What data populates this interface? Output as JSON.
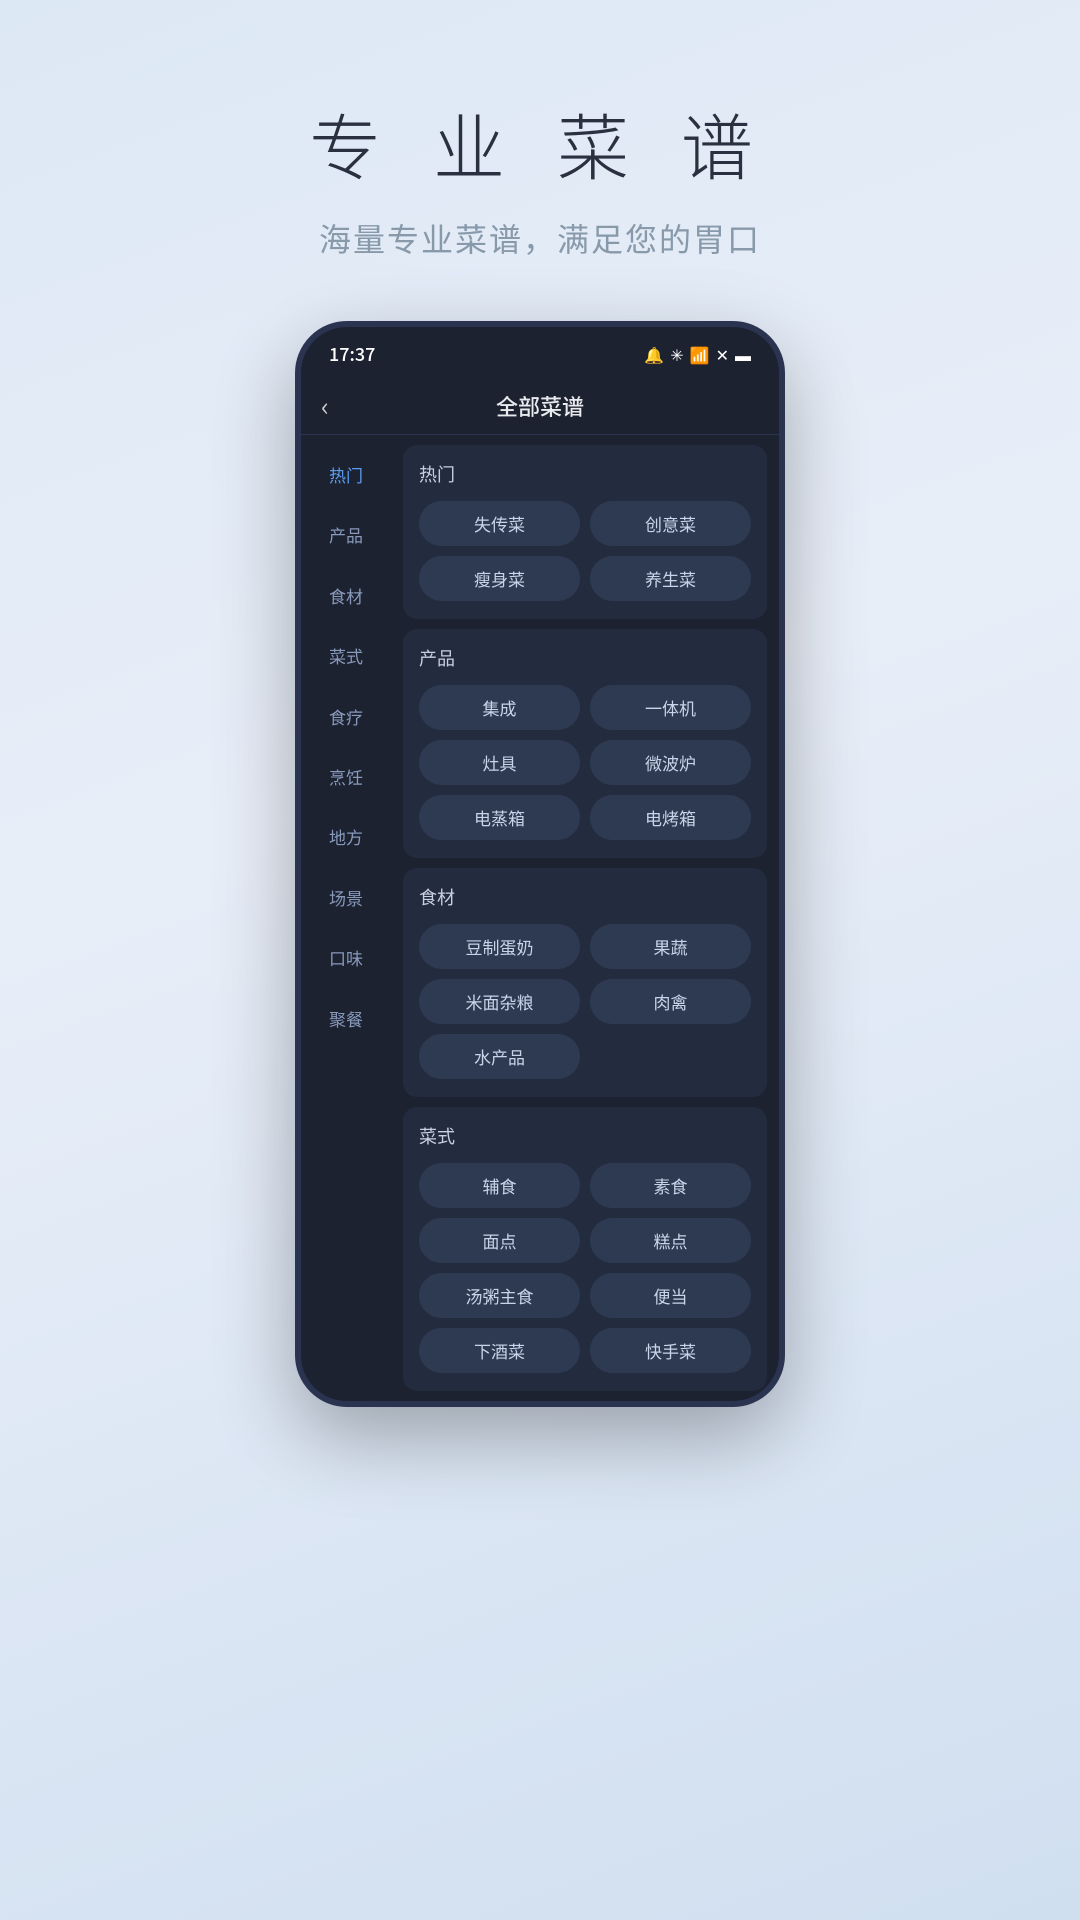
{
  "header": {
    "title": "专 业 菜 谱",
    "subtitle": "海量专业菜谱，满足您的胃口"
  },
  "statusBar": {
    "time": "17:37",
    "icons": "🔔 ✳ 📶 ✕ 🔋"
  },
  "nav": {
    "backLabel": "‹",
    "title": "全部菜谱"
  },
  "sidebar": {
    "items": [
      {
        "label": "热门",
        "active": true
      },
      {
        "label": "产品",
        "active": false
      },
      {
        "label": "食材",
        "active": false
      },
      {
        "label": "菜式",
        "active": false
      },
      {
        "label": "食疗",
        "active": false
      },
      {
        "label": "烹饪",
        "active": false
      },
      {
        "label": "地方",
        "active": false
      },
      {
        "label": "场景",
        "active": false
      },
      {
        "label": "口味",
        "active": false
      },
      {
        "label": "聚餐",
        "active": false
      }
    ]
  },
  "categories": [
    {
      "label": "热门",
      "tags": [
        {
          "text": "失传菜",
          "fullWidth": false
        },
        {
          "text": "创意菜",
          "fullWidth": false
        },
        {
          "text": "瘦身菜",
          "fullWidth": false
        },
        {
          "text": "养生菜",
          "fullWidth": false
        }
      ]
    },
    {
      "label": "产品",
      "tags": [
        {
          "text": "集成",
          "fullWidth": false
        },
        {
          "text": "一体机",
          "fullWidth": false
        },
        {
          "text": "灶具",
          "fullWidth": false
        },
        {
          "text": "微波炉",
          "fullWidth": false
        },
        {
          "text": "电蒸箱",
          "fullWidth": false
        },
        {
          "text": "电烤箱",
          "fullWidth": false
        }
      ]
    },
    {
      "label": "食材",
      "tags": [
        {
          "text": "豆制蛋奶",
          "fullWidth": false
        },
        {
          "text": "果蔬",
          "fullWidth": false
        },
        {
          "text": "米面杂粮",
          "fullWidth": false
        },
        {
          "text": "肉禽",
          "fullWidth": false
        },
        {
          "text": "水产品",
          "fullWidth": true
        }
      ]
    },
    {
      "label": "菜式",
      "tags": [
        {
          "text": "辅食",
          "fullWidth": false
        },
        {
          "text": "素食",
          "fullWidth": false
        },
        {
          "text": "面点",
          "fullWidth": false
        },
        {
          "text": "糕点",
          "fullWidth": false
        },
        {
          "text": "汤粥主食",
          "fullWidth": false
        },
        {
          "text": "便当",
          "fullWidth": false
        },
        {
          "text": "下酒菜",
          "fullWidth": false
        },
        {
          "text": "快手菜",
          "fullWidth": false
        }
      ]
    }
  ]
}
